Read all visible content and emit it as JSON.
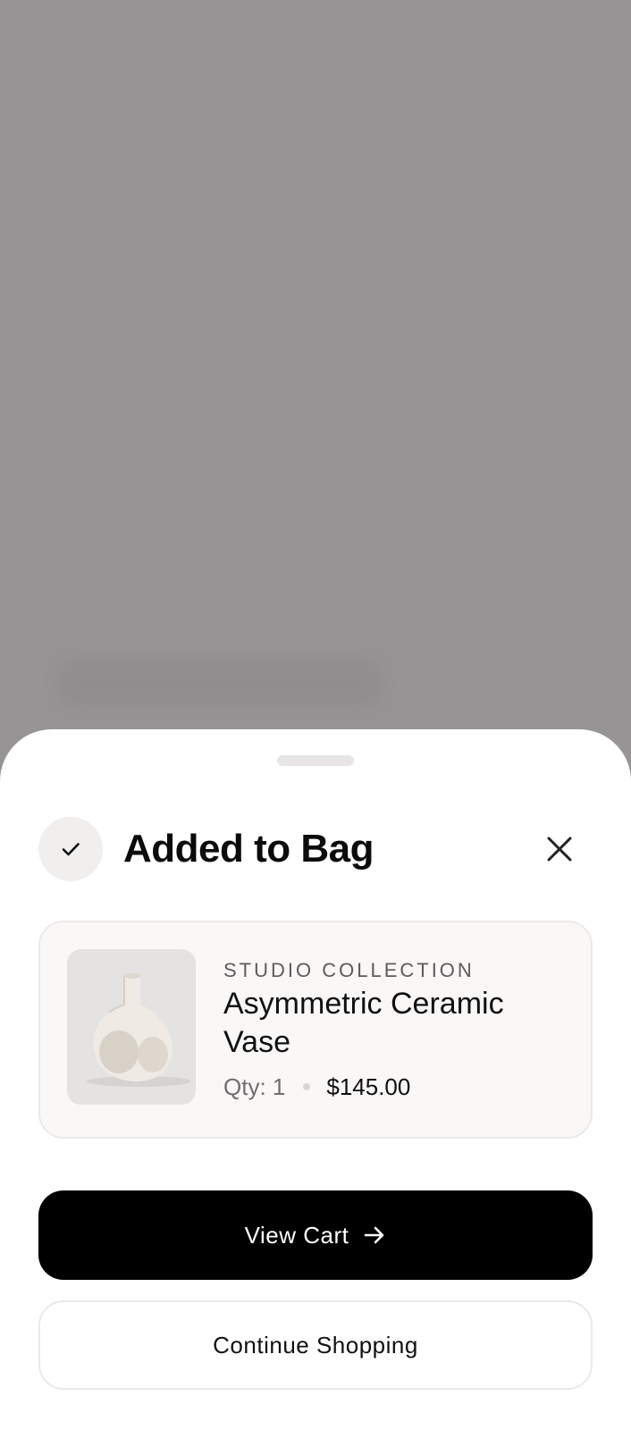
{
  "sheet": {
    "title": "Added to Bag",
    "icons": {
      "status": "check-icon",
      "close": "close-icon"
    }
  },
  "product": {
    "brand": "STUDIO COLLECTION",
    "name": "Asymmetric Ceramic Vase",
    "qty": "Qty: 1",
    "price": "$145.00",
    "image": "vase-image"
  },
  "actions": {
    "primary_label": "View Cart",
    "primary_icon": "arrow-right-icon",
    "secondary_label": "Continue Shopping"
  },
  "colors": {
    "overlay": "#969495",
    "primary_button": "#000000",
    "card_background": "#faf8f7"
  }
}
